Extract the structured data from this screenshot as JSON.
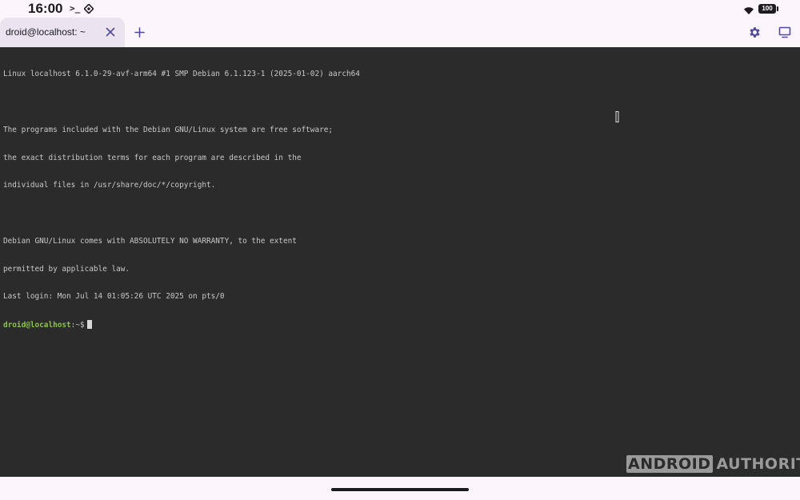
{
  "status_bar": {
    "time": "16:00",
    "terminal_indicator": ">_",
    "battery_level": "100",
    "icons": [
      "terminal-icon",
      "vpn-icon",
      "wifi-icon",
      "battery-icon"
    ]
  },
  "tabs": [
    {
      "label": "droid@localhost: ~",
      "active": true
    }
  ],
  "toolbar": {
    "icons": [
      "close-icon",
      "plus-icon",
      "gear-icon",
      "display-icon"
    ]
  },
  "terminal": {
    "lines": [
      "Linux localhost 6.1.0-29-avf-arm64 #1 SMP Debian 6.1.123-1 (2025-01-02) aarch64",
      "",
      "The programs included with the Debian GNU/Linux system are free software;",
      "the exact distribution terms for each program are described in the",
      "individual files in /usr/share/doc/*/copyright.",
      "",
      "Debian GNU/Linux comes with ABSOLUTELY NO WARRANTY, to the extent",
      "permitted by applicable law.",
      "Last login: Mon Jul 14 01:05:26 UTC 2025 on pts/0"
    ],
    "prompt_user": "droid@localhost",
    "prompt_path": ":~$",
    "colors": {
      "background": "#2b2b2b",
      "text": "#c8c8c8",
      "prompt_user": "#8bc34a"
    }
  },
  "watermark": {
    "boxed": "ANDROID",
    "plain": "AUTHORITY"
  }
}
